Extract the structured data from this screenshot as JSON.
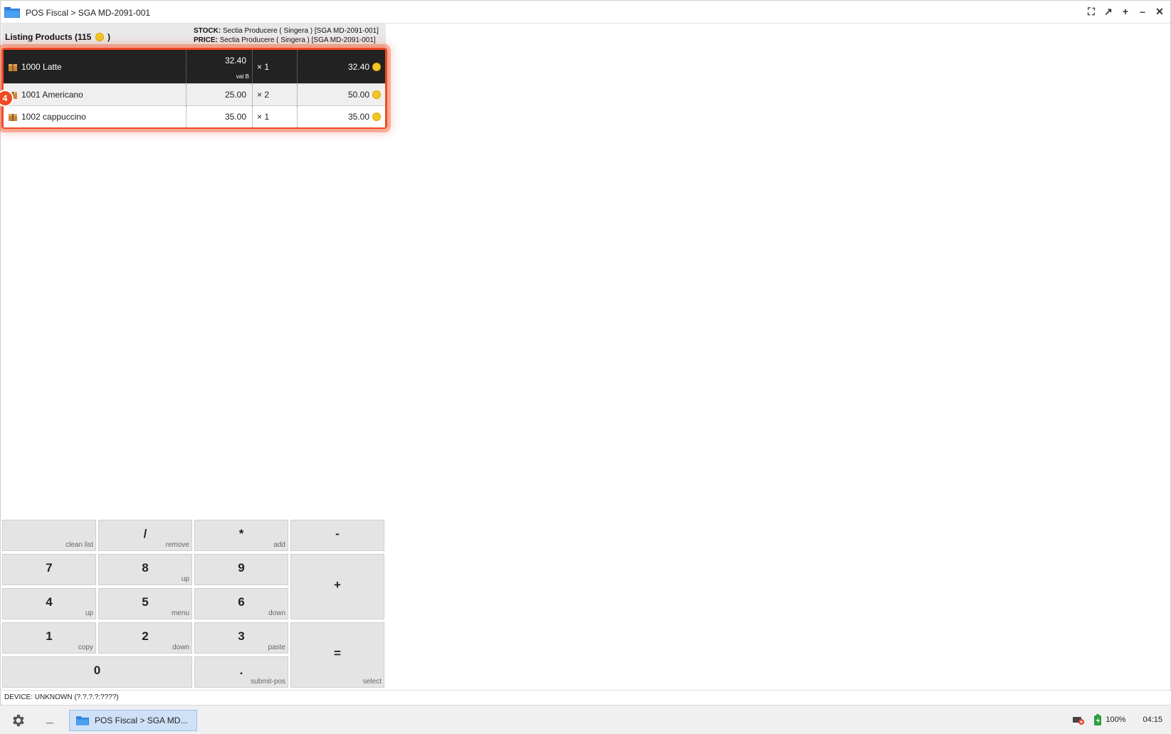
{
  "window": {
    "title": "POS Fiscal > SGA MD-2091-001",
    "controls": {
      "fullscreen": "⛶",
      "restore": "↗",
      "maximize": "+",
      "minimize": "–",
      "close": "✕"
    }
  },
  "listing": {
    "title_prefix": "Listing Products (115",
    "title_suffix": ")",
    "stock_label": "STOCK:",
    "stock_value": "Sectia Producere ( Singera ) [SGA MD-2091-001]",
    "price_label": "PRICE:",
    "price_value": "Sectia Producere ( Singera ) [SGA MD-2091-001]",
    "badge": "4"
  },
  "items": [
    {
      "name": "1000 Latte",
      "price": "32.40",
      "vat": "vat B",
      "qty": "× 1",
      "total": "32.40"
    },
    {
      "name": "1001 Americano",
      "price": "25.00",
      "qty": "× 2",
      "total": "50.00"
    },
    {
      "name": "1002 cappuccino",
      "price": "35.00",
      "qty": "× 1",
      "total": "35.00"
    }
  ],
  "keypad": {
    "clean": {
      "main": "",
      "sub": "clean list"
    },
    "div": {
      "main": "/",
      "sub": "remove"
    },
    "mul": {
      "main": "*",
      "sub": "add"
    },
    "minus": {
      "main": "-",
      "sub": ""
    },
    "k7": {
      "main": "7",
      "sub": ""
    },
    "k8": {
      "main": "8",
      "sub": "up"
    },
    "k9": {
      "main": "9",
      "sub": ""
    },
    "plus": {
      "main": "+",
      "sub": ""
    },
    "k4": {
      "main": "4",
      "sub": "up"
    },
    "k5": {
      "main": "5",
      "sub": "menu"
    },
    "k6": {
      "main": "6",
      "sub": "down"
    },
    "k1": {
      "main": "1",
      "sub": "copy"
    },
    "k2": {
      "main": "2",
      "sub": "down"
    },
    "k3": {
      "main": "3",
      "sub": "paste"
    },
    "eq": {
      "main": "=",
      "sub": "select"
    },
    "k0": {
      "main": "0",
      "sub": ""
    },
    "dot": {
      "main": ".",
      "sub": "submit-pos"
    }
  },
  "device": {
    "status": "DEVICE: UNKNOWN (?.?.?.?:????)"
  },
  "taskbar": {
    "task_label": "POS Fiscal > SGA MD...",
    "battery": "100%",
    "time": "04:15"
  },
  "colors": {
    "highlight": "#f04a23",
    "selected_row": "#222222",
    "coin": "#f3c623",
    "task_active": "#cfe1f7"
  }
}
